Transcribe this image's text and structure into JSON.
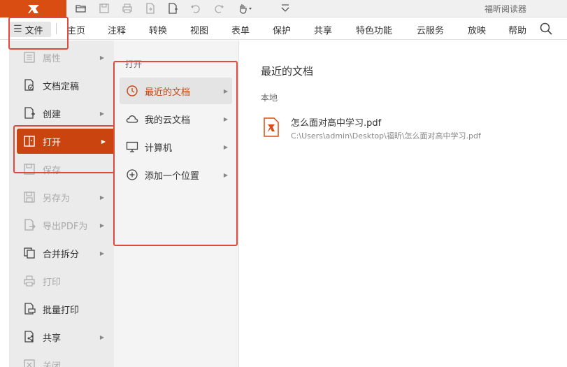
{
  "app": {
    "title": "福昕阅读器",
    "accent_color": "#c9440e",
    "logo_color": "#d94c12"
  },
  "quick_access": [
    {
      "icon": "folder-open-icon"
    },
    {
      "icon": "save-icon"
    },
    {
      "icon": "print-icon"
    },
    {
      "icon": "file-export-icon"
    },
    {
      "icon": "new-document-icon"
    },
    {
      "icon": "undo-icon"
    },
    {
      "icon": "redo-icon"
    },
    {
      "icon": "hand-tool-icon"
    },
    {
      "icon": "customize-dropdown-icon"
    }
  ],
  "menubar": {
    "file_button": "文件",
    "items": [
      "主页",
      "注释",
      "转换",
      "视图",
      "表单",
      "保护",
      "共享",
      "特色功能",
      "云服务",
      "放映",
      "帮助"
    ]
  },
  "left_panel": {
    "items": [
      {
        "label": "属性",
        "icon": "properties-icon",
        "disabled": true,
        "arrow": true
      },
      {
        "label": "文档定稿",
        "icon": "document-finalize-icon",
        "disabled": false,
        "arrow": false
      },
      {
        "label": "创建",
        "icon": "create-icon",
        "disabled": false,
        "arrow": true
      },
      {
        "label": "打开",
        "icon": "open-icon",
        "disabled": false,
        "arrow": true,
        "active": true
      },
      {
        "label": "保存",
        "icon": "save-icon",
        "disabled": true,
        "arrow": false
      },
      {
        "label": "另存为",
        "icon": "save-as-icon",
        "disabled": true,
        "arrow": true
      },
      {
        "label": "导出PDF为",
        "icon": "export-pdf-icon",
        "disabled": true,
        "arrow": true
      },
      {
        "label": "合并拆分",
        "icon": "merge-split-icon",
        "disabled": false,
        "arrow": true
      },
      {
        "label": "打印",
        "icon": "print-icon",
        "disabled": true,
        "arrow": false
      },
      {
        "label": "批量打印",
        "icon": "batch-print-icon",
        "disabled": false,
        "arrow": false
      },
      {
        "label": "共享",
        "icon": "share-icon",
        "disabled": false,
        "arrow": true
      },
      {
        "label": "关闭",
        "icon": "close-icon",
        "disabled": true,
        "arrow": false
      }
    ]
  },
  "open_submenu": {
    "heading": "打开",
    "items": [
      {
        "label": "最近的文档",
        "icon": "clock-icon",
        "selected": true
      },
      {
        "label": "我的云文档",
        "icon": "cloud-icon",
        "selected": false
      },
      {
        "label": "计算机",
        "icon": "computer-icon",
        "selected": false
      },
      {
        "label": "添加一个位置",
        "icon": "add-location-icon",
        "selected": false
      }
    ]
  },
  "recent": {
    "title": "最近的文档",
    "section_label": "本地",
    "files": [
      {
        "name": "怎么面对高中学习.pdf",
        "path": "C:\\Users\\admin\\Desktop\\福昕\\怎么面对高中学习.pdf"
      }
    ]
  }
}
